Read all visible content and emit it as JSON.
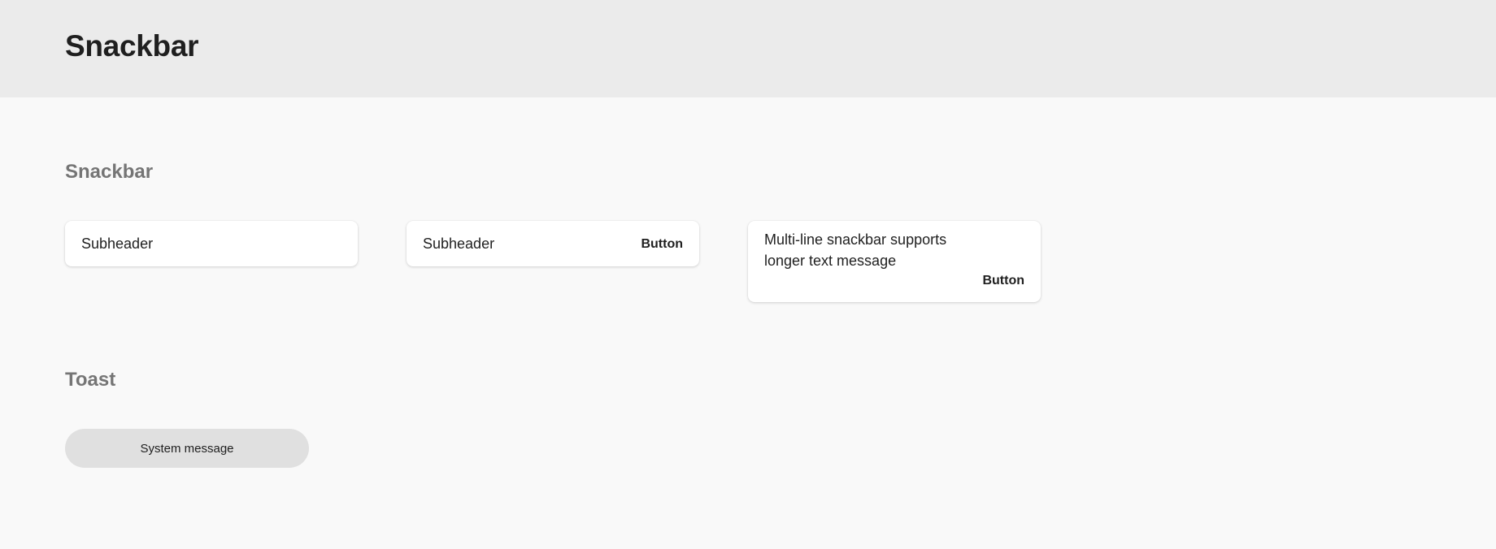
{
  "header": {
    "title": "Snackbar"
  },
  "sections": {
    "snackbar": {
      "title": "Snackbar",
      "items": [
        {
          "text": "Subheader"
        },
        {
          "text": "Subheader",
          "button": "Button"
        },
        {
          "text_line1": "Multi-line snackbar supports",
          "text_line2": "longer text message",
          "button": "Button"
        }
      ]
    },
    "toast": {
      "title": "Toast",
      "message": "System message"
    }
  },
  "colors": {
    "header_bg": "#ebebeb",
    "page_bg": "#f9f9f9",
    "section_title": "#757575",
    "toast_bg": "#e0e0e0",
    "text": "#1f1f1f"
  }
}
